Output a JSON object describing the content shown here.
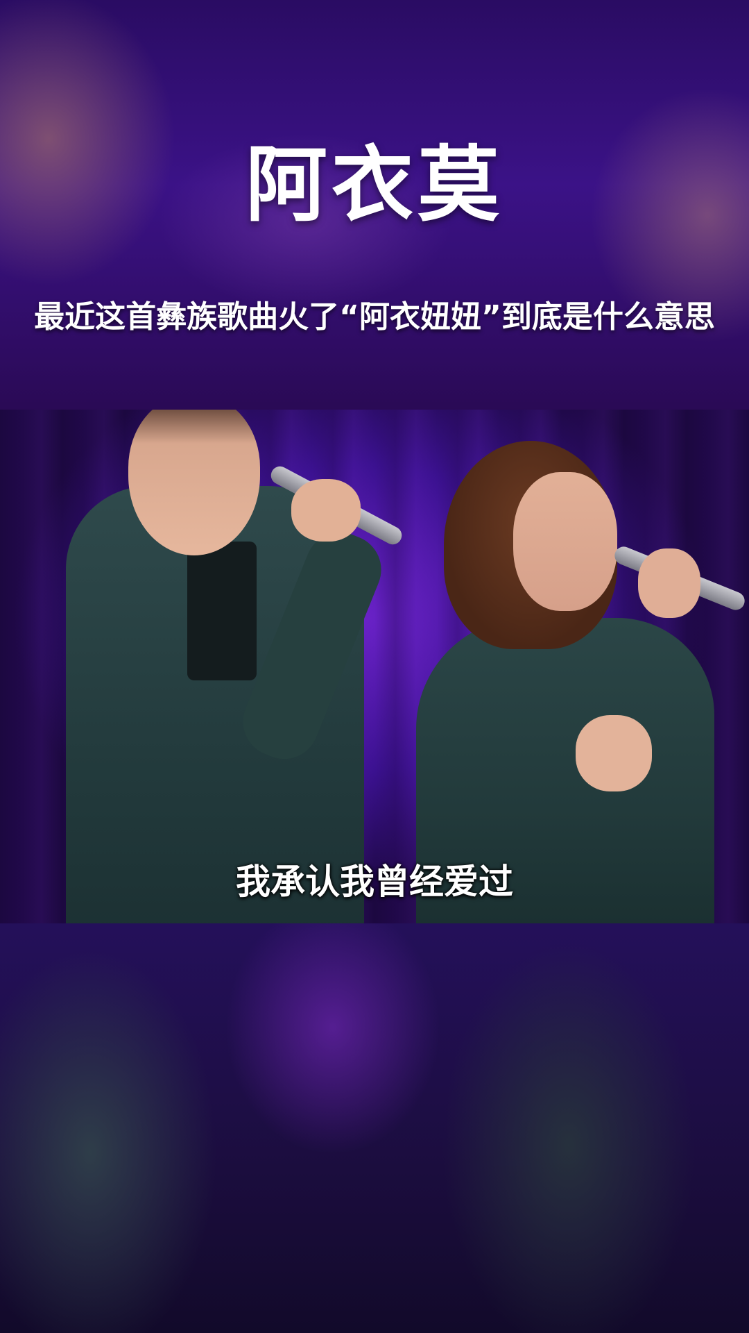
{
  "header": {
    "title": "阿衣莫",
    "subtitle": "最近这首彝族歌曲火了“阿衣妞妞”到底是什么意思"
  },
  "video": {
    "subtitle_caption": "我承认我曾经爱过"
  }
}
